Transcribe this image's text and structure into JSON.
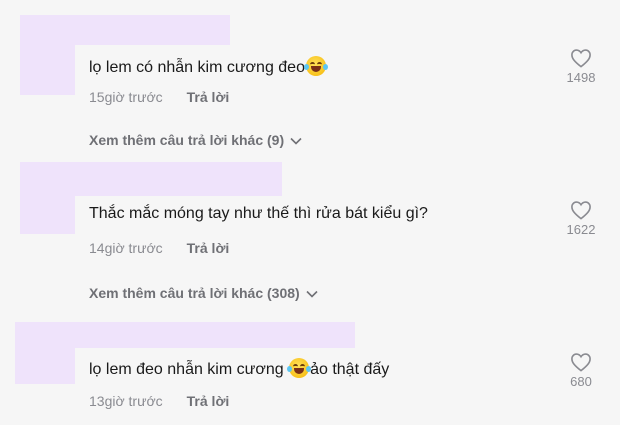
{
  "comments": [
    {
      "text_before": "lọ lem có nhẫn kim cương đeo",
      "emoji": "tears-of-joy-emoji",
      "text_after": "",
      "time": "15giờ trước",
      "reply_label": "Trả lời",
      "likes": "1498",
      "more_replies": "Xem thêm câu trả lời khác (9)"
    },
    {
      "text_before": "Thắc mắc móng tay như thế thì rửa bát kiểu gì?",
      "emoji": "",
      "text_after": "",
      "time": "14giờ trước",
      "reply_label": "Trả lời",
      "likes": "1622",
      "more_replies": "Xem thêm câu trả lời khác (308)"
    },
    {
      "text_before": "lọ lem đeo nhẫn kim cương ",
      "emoji": "tears-of-joy-emoji",
      "text_after": "ảo thật đấy",
      "time": "13giờ trước",
      "reply_label": "Trả lời",
      "likes": "680",
      "more_replies": ""
    }
  ],
  "colors": {
    "background": "#f6f6f6",
    "redaction": "#efe3fb",
    "meta_text": "#8a8b91"
  },
  "icons": {
    "like": "heart-outline-icon",
    "expand": "chevron-down-icon"
  }
}
